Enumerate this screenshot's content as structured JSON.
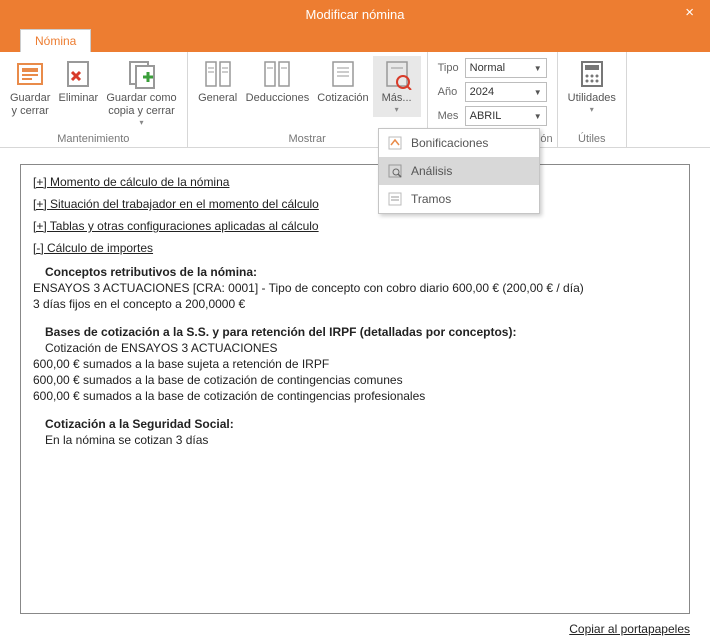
{
  "window": {
    "title": "Modificar nómina",
    "close": "×"
  },
  "tabs": {
    "nomina": "Nómina"
  },
  "ribbon": {
    "mantenimiento": {
      "label": "Mantenimiento",
      "guardar_cerrar": "Guardar\ny cerrar",
      "eliminar": "Eliminar",
      "guardar_copia": "Guardar como\ncopia y cerrar"
    },
    "mostrar": {
      "label": "Mostrar",
      "general": "General",
      "deducciones": "Deducciones",
      "cotizacion": "Cotización",
      "mas": "Más..."
    },
    "period": {
      "tipo_label": "Tipo",
      "tipo_value": "Normal",
      "ano_label": "Año",
      "ano_value": "2024",
      "mes_label": "Mes",
      "mes_value": "ABRIL",
      "cut": "ación"
    },
    "utiles": {
      "label": "Útiles",
      "utilidades": "Utilidades"
    }
  },
  "dropdown": {
    "bonificaciones": "Bonificaciones",
    "analisis": "Análisis",
    "tramos": "Tramos"
  },
  "doc": {
    "l1": "[+] Momento de cálculo de la nómina",
    "l2": "[+] Situación del trabajador en el momento del cálculo",
    "l3": "[+] Tablas y otras configuraciones aplicadas al cálculo",
    "l4": "[-] Cálculo de importes",
    "conceptos_head": "Conceptos retributivos de la nómina:",
    "concepto_line": "ENSAYOS 3 ACTUACIONES [CRA: 0001] - Tipo de concepto con cobro diario 600,00 € (200,00 € / día)",
    "concepto_sub": "3 días fijos en el concepto a 200,0000 €",
    "bases_head": "Bases de cotización a la S.S. y para retención del IRPF (detalladas por conceptos):",
    "bases_sub": "Cotización de ENSAYOS 3 ACTUACIONES",
    "b1": "600,00 € sumados a la base sujeta a retención de IRPF",
    "b2": "600,00 € sumados a la base de cotización de contingencias comunes",
    "b3": "600,00 € sumados a la base de cotización de contingencias profesionales",
    "cotss_head": "Cotización a la Seguridad Social:",
    "cotss_line": "En la nómina se cotizan 3 días"
  },
  "footer": {
    "copy": "Copiar al portapapeles"
  }
}
